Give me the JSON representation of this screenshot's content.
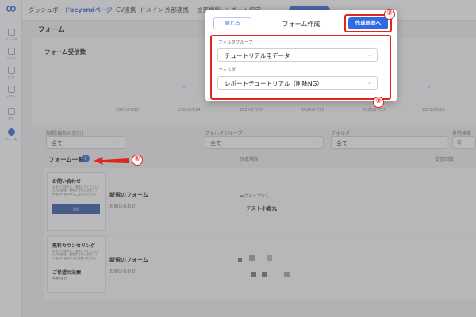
{
  "nav": {
    "items": [
      "ダッシュボード",
      "beyondページ",
      "CV連携",
      "ドメイン",
      "外部連携",
      "拡張機能",
      "レポート設定"
    ]
  },
  "sidebar": {
    "items": [
      "フォルダ",
      "ページ",
      "計測",
      "テスト",
      "会社",
      "フォーム"
    ]
  },
  "page": {
    "title": "フォーム"
  },
  "chart_panel": {
    "title": "フォーム受信数",
    "dates": [
      "2025/07/23",
      "2025/07/24",
      "2025/07/25",
      "2025/07/26",
      "2025/07/27",
      "2025/07/28"
    ]
  },
  "filters": {
    "period_label": "期間(最新の受付)",
    "period_value": "全て",
    "group_label": "フォルダグループ",
    "group_value": "全て",
    "folder_label": "フォルダ",
    "folder_value": "全て",
    "search_label": "名前検索",
    "search_placeholder": "Q"
  },
  "list": {
    "title": "フォーム一覧",
    "add_icon": "plus-icon",
    "col_location": "作成場所",
    "col_count": "受信回数",
    "rows": [
      {
        "thumb_title": "お問い合わせ",
        "thumb_text": "以下より記入し、送信してください。入力内容は、管理できない文字（ ）が含まれますのでご注意ください。",
        "thumb_button": "送信",
        "name": "新規のフォーム",
        "sub": "お問い合わせ",
        "location_group": "グループなし",
        "location_page": "テスト小倉丸"
      },
      {
        "thumb_title": "無料カウンセリング",
        "thumb_text": "以下より記入し、送信してください。入力内容は、管理できない文字（ ）が含まれますのでご注意ください。",
        "thumb_sub_title": "ご希望の治療",
        "thumb_small": "体験希望日",
        "name": "新規のフォーム",
        "sub": "お問い合わせ"
      }
    ]
  },
  "modal": {
    "title": "フォーム作成",
    "close_label": "閉じる",
    "create_label": "作成画面へ",
    "group_label": "フォルダグループ",
    "group_value": "チュートリアル用データ",
    "folder_label": "フォルダ",
    "folder_value": "レポートチュートリアル（削除NG）"
  },
  "annotations": {
    "n1": "①",
    "n2": "②",
    "n3": "③",
    "highlight_color": "#e1251b"
  },
  "colors": {
    "accent": "#2d6ae3"
  }
}
